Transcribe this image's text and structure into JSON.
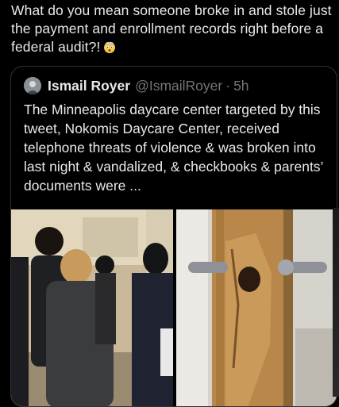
{
  "post": {
    "text": "What do you mean someone broke in and stole just the payment and enrollment records right before a federal audit?!",
    "emoji": "exploding-head-emoji"
  },
  "quote": {
    "name": "Ismail Royer",
    "handle": "@IsmailRoyer",
    "separator": "·",
    "time": "5h",
    "text": "The Minneapolis daycare center targeted by this tweet, Nokomis Daycare Center, received telephone threats of violence & was broken into last night & vandalized, & checkbooks & parents’ documents were ..."
  },
  "media": {
    "left_alt": "people standing in daycare hallway",
    "right_alt": "damaged wooden door with broken lock"
  },
  "colors": {
    "background": "#000000",
    "text": "#e7e9ea",
    "muted": "#71767b",
    "border": "#2f3336"
  }
}
